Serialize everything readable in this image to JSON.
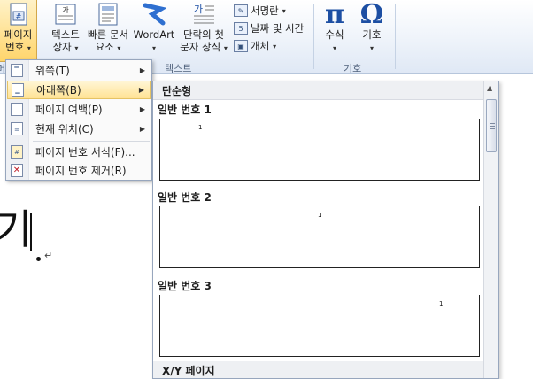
{
  "ribbon": {
    "page_number": {
      "line1": "페이지",
      "line2": "번호",
      "caret": "▾"
    },
    "text_box": {
      "line1": "텍스트",
      "line2": "상자",
      "caret": "▾"
    },
    "quick_parts": {
      "line1": "빠른 문서",
      "line2": "요소",
      "caret": "▾"
    },
    "wordart": {
      "line1": "WordArt",
      "caret": "▾"
    },
    "drop_cap": {
      "line1": "단락의 첫",
      "line2": "문자 장식",
      "caret": "▾"
    },
    "signature": {
      "label": "서명란",
      "caret": "▾"
    },
    "date_time": {
      "label": "날짜 및 시간"
    },
    "object": {
      "label": "개체",
      "caret": "▾"
    },
    "equation": {
      "label": "수식",
      "glyph": "π",
      "caret": "▾"
    },
    "symbol": {
      "label": "기호",
      "glyph": "Ω",
      "caret": "▾"
    },
    "group_text": "텍스트",
    "group_symbols": "기호",
    "left_group_fragment": "머"
  },
  "document": {
    "char": "기",
    "para_mark": "↵"
  },
  "menu": {
    "items": [
      {
        "label": "위쪽(T)",
        "arrow": "▶"
      },
      {
        "label": "아래쪽(B)",
        "arrow": "▶"
      },
      {
        "label": "페이지 여백(P)",
        "arrow": "▶"
      },
      {
        "label": "현재 위치(C)",
        "arrow": "▶"
      },
      {
        "label": "페이지 번호 서식(F)..."
      },
      {
        "label": "페이지 번호 제거(R)"
      }
    ]
  },
  "gallery": {
    "category_simple": "단순형",
    "items": [
      {
        "label": "일반 번호 1",
        "number": "1"
      },
      {
        "label": "일반 번호 2",
        "number": "1"
      },
      {
        "label": "일반 번호 3",
        "number": "1"
      }
    ],
    "category_xy": "X/Y 페이지",
    "scroll_up": "▲"
  }
}
